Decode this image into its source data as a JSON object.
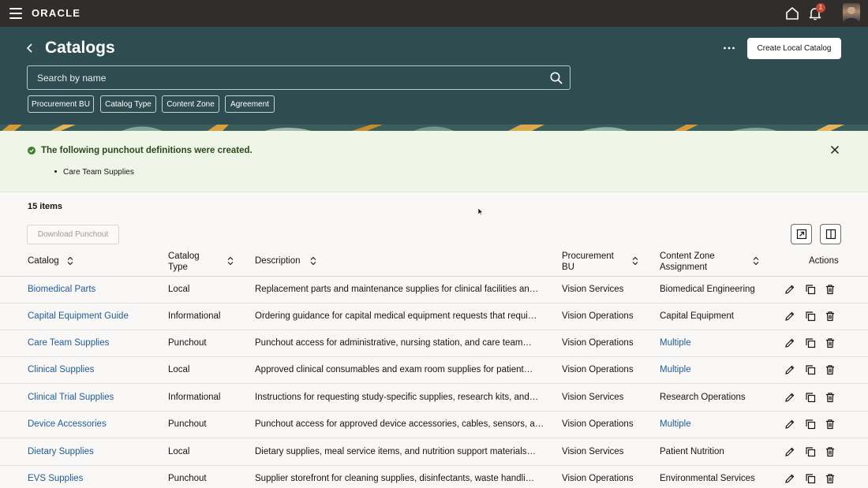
{
  "topbar": {
    "logo": "ORACLE",
    "notification_count": "1",
    "icons": [
      "menu-icon",
      "home-icon",
      "bell-icon",
      "avatar"
    ]
  },
  "header": {
    "title": "Catalogs",
    "create_button": "Create Local Catalog",
    "search_placeholder": "Search by name",
    "filters": [
      "Procurement BU",
      "Catalog Type",
      "Content Zone",
      "Agreement"
    ]
  },
  "message": {
    "title": "The following punchout definitions were created.",
    "items": [
      "Care Team Supplies"
    ]
  },
  "list": {
    "count_label": "15 items",
    "download_label": "Download Punchout",
    "columns": {
      "catalog": "Catalog",
      "catalog_type_1": "Catalog",
      "catalog_type_2": "Type",
      "description": "Description",
      "bu_1": "Procurement",
      "bu_2": "BU",
      "zone_1": "Content Zone",
      "zone_2": "Assignment",
      "actions": "Actions"
    },
    "rows": [
      {
        "catalog": "Biomedical Parts",
        "type": "Local",
        "description": "Replacement parts and maintenance supplies for clinical facilities an…",
        "bu": "Vision Services",
        "zone": "Biomedical Engineering"
      },
      {
        "catalog": "Capital Equipment Guide",
        "type": "Informational",
        "description": "Ordering guidance for capital medical equipment requests that requi…",
        "bu": "Vision Operations",
        "zone": "Capital Equipment"
      },
      {
        "catalog": "Care Team Supplies",
        "type": "Punchout",
        "description": "Punchout access for administrative, nursing station, and care team…",
        "bu": "Vision Operations",
        "zone": "Multiple"
      },
      {
        "catalog": "Clinical Supplies",
        "type": "Local",
        "description": "Approved clinical consumables and exam room supplies for patient…",
        "bu": "Vision Operations",
        "zone": "Multiple"
      },
      {
        "catalog": "Clinical Trial Supplies",
        "type": "Informational",
        "description": "Instructions for requesting study-specific supplies, research kits, and…",
        "bu": "Vision Services",
        "zone": "Research Operations"
      },
      {
        "catalog": "Device Accessories",
        "type": "Punchout",
        "description": "Punchout access for approved device accessories, cables, sensors, a…",
        "bu": "Vision Operations",
        "zone": "Multiple"
      },
      {
        "catalog": "Dietary Supplies",
        "type": "Local",
        "description": "Dietary supplies, meal service items, and nutrition support materials…",
        "bu": "Vision Services",
        "zone": "Patient Nutrition"
      },
      {
        "catalog": "EVS Supplies",
        "type": "Punchout",
        "description": "Supplier storefront for cleaning supplies, disinfectants, waste handli…",
        "bu": "Vision Operations",
        "zone": "Environmental Services"
      }
    ]
  },
  "colors": {
    "topbar": "#312d2a",
    "header": "#2f4c50",
    "link": "#1f5a9c",
    "success_bg": "#eff6e8",
    "badge": "#c74634"
  }
}
